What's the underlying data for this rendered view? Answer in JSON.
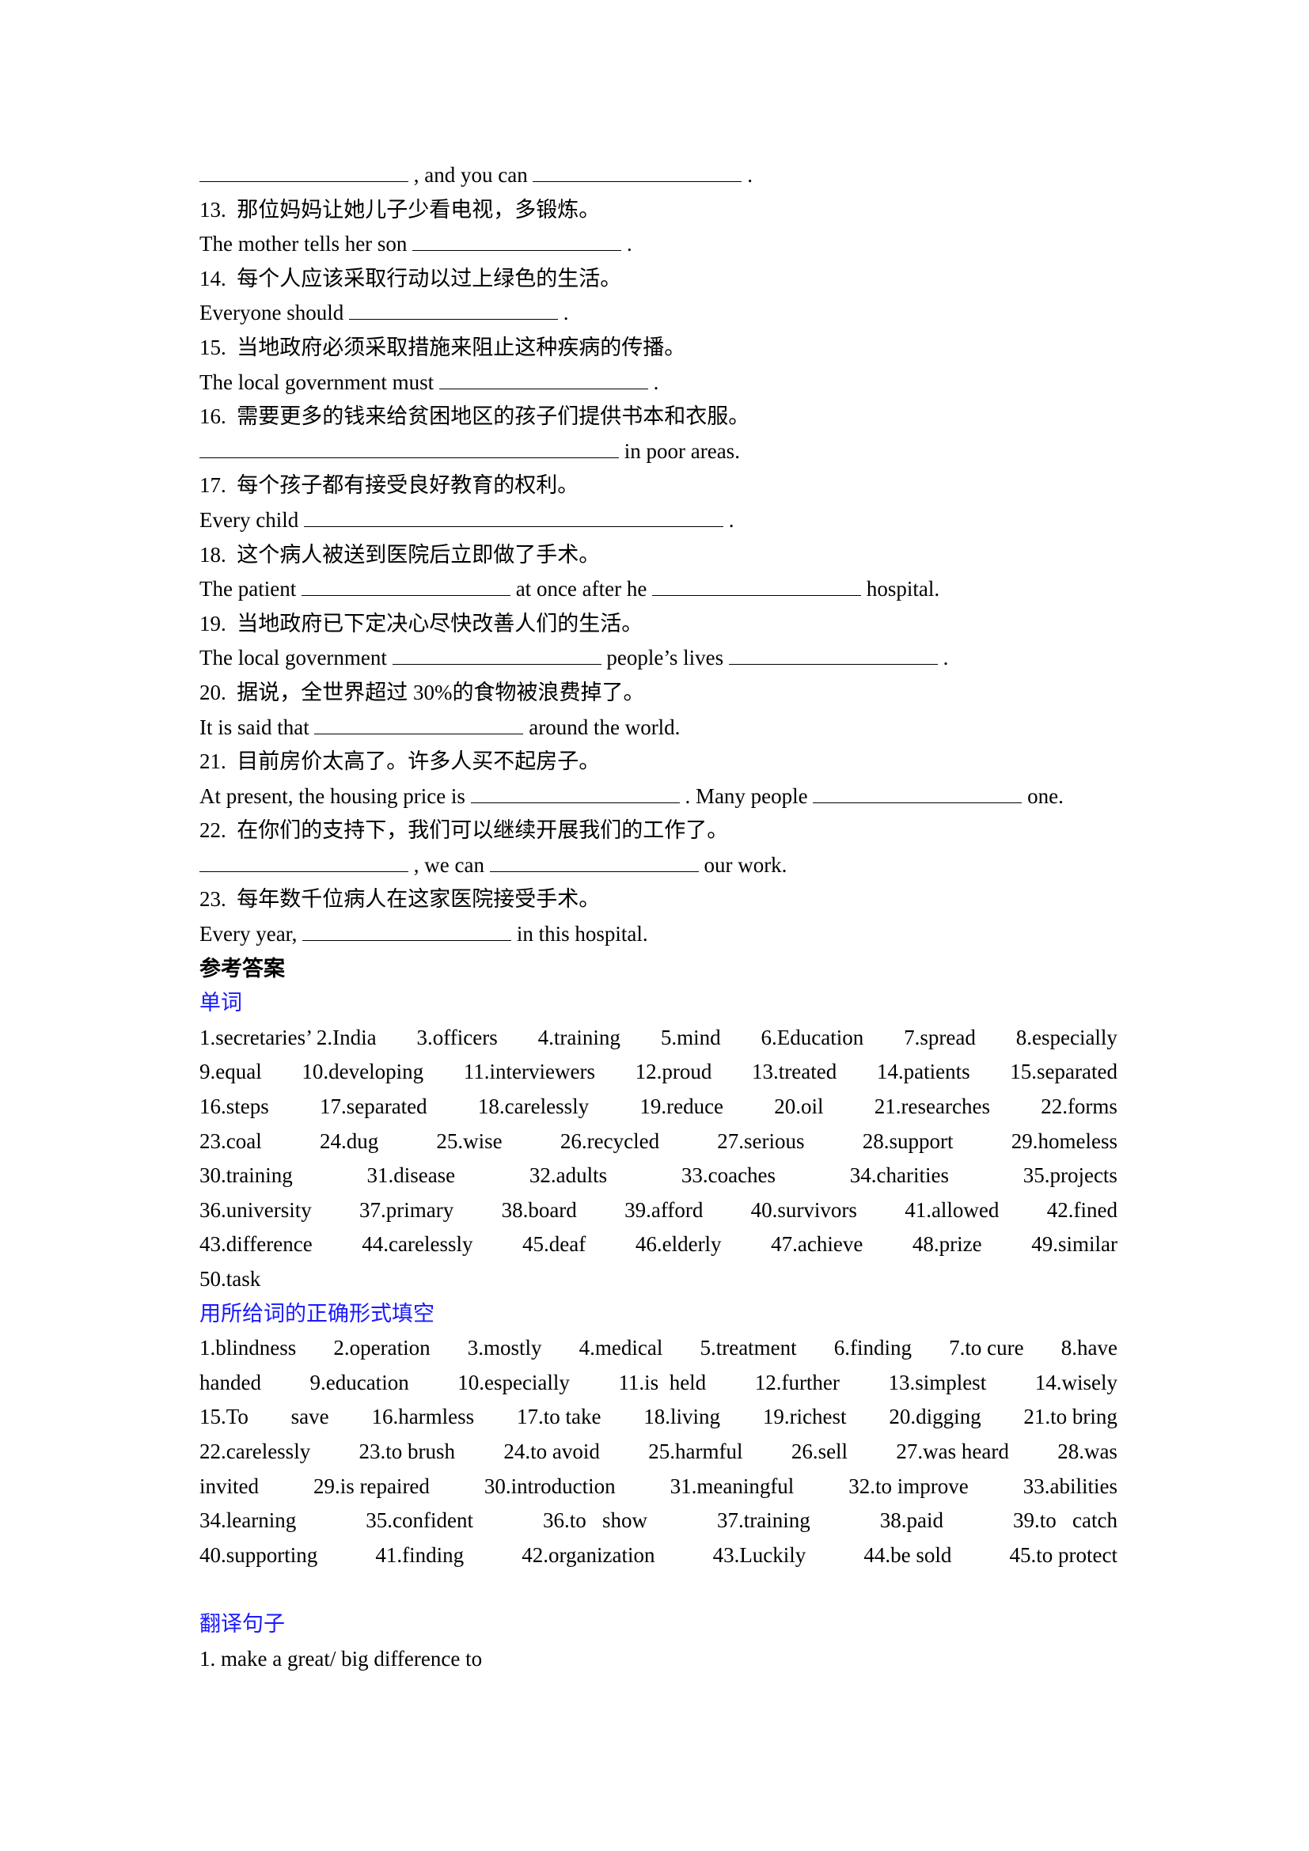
{
  "questions": {
    "q12_cont": {
      "mid": ", and you can",
      "end": "."
    },
    "q13": {
      "cn": "13.  那位妈妈让她儿子少看电视，多锻炼。",
      "en_start": "The mother tells her son",
      "end": "."
    },
    "q14": {
      "cn": "14.  每个人应该采取行动以过上绿色的生活。",
      "en_start": "Everyone should",
      "end": "."
    },
    "q15": {
      "cn": "15.  当地政府必须采取措施来阻止这种疾病的传播。",
      "en_start": "The local government must",
      "end": "."
    },
    "q16": {
      "cn": "16.  需要更多的钱来给贫困地区的孩子们提供书本和衣服。",
      "en_end": "in poor areas."
    },
    "q17": {
      "cn": "17.  每个孩子都有接受良好教育的权利。",
      "en_start": "Every child",
      "end": "."
    },
    "q18": {
      "cn": "18.  这个病人被送到医院后立即做了手术。",
      "en_start": "The patient",
      "mid": "at once after he",
      "end": "hospital."
    },
    "q19": {
      "cn": "19.  当地政府已下定决心尽快改善人们的生活。",
      "en_start": "The local government",
      "mid": "people’s lives",
      "end": "."
    },
    "q20": {
      "cn": "20.  据说，全世界超过 30%的食物被浪费掉了。",
      "en_start": "It is said that",
      "end": "around the world."
    },
    "q21": {
      "cn": "21.  目前房价太高了。许多人买不起房子。",
      "en_start": "At present, the housing price is",
      "mid": ". Many people",
      "end": "one."
    },
    "q22": {
      "cn": "22.  在你们的支持下，我们可以继续开展我们的工作了。",
      "mid": ", we can",
      "end": "our work."
    },
    "q23": {
      "cn": "23.  每年数千位病人在这家医院接受手术。",
      "en_start": "Every year,",
      "end": "in this hospital."
    }
  },
  "answers": {
    "heading": "参考答案",
    "vocab": {
      "title": "单词",
      "rows": [
        [
          "1.secretaries’ 2.India",
          "3.officers",
          "4.training",
          "5.mind",
          "6.Education",
          "7.spread",
          "8.especially"
        ],
        [
          "9.equal",
          "10.developing",
          "11.interviewers",
          "12.proud",
          "13.treated",
          "14.patients",
          "15.separated"
        ],
        [
          "16.steps",
          "17.separated",
          "18.carelessly",
          "19.reduce",
          "20.oil",
          "21.researches",
          "22.forms"
        ],
        [
          "23.coal",
          "24.dug",
          "25.wise",
          "26.recycled",
          "27.serious",
          "28.support",
          "29.homeless"
        ],
        [
          "30.training",
          "31.disease",
          "32.adults",
          "33.coaches",
          "34.charities",
          "35.projects"
        ],
        [
          "36.university",
          "37.primary",
          "38.board",
          "39.afford",
          "40.survivors",
          "41.allowed",
          "42.fined"
        ],
        [
          "43.difference",
          "44.carelessly",
          "45.deaf",
          "46.elderly",
          "47.achieve",
          "48.prize",
          "49.similar"
        ],
        [
          "50.task"
        ]
      ]
    },
    "fill": {
      "title": "用所给词的正确形式填空",
      "rows": [
        [
          "1.blindness",
          "2.operation",
          "3.mostly",
          "4.medical",
          "5.treatment",
          "6.finding",
          "7.to cure",
          "8.have"
        ],
        [
          "handed",
          "9.education",
          "10.especially",
          "11.is  held",
          "12.further",
          "13.simplest",
          "14.wisely"
        ],
        [
          "15.To",
          "save",
          "16.harmless",
          "17.to take",
          "18.living",
          "19.richest",
          "20.digging",
          "21.to bring"
        ],
        [
          "22.carelessly",
          "23.to brush",
          "24.to avoid",
          "25.harmful",
          "26.sell",
          "27.was heard",
          "28.was"
        ],
        [
          "invited",
          "29.is repaired",
          "30.introduction",
          "31.meaningful",
          "32.to improve",
          "33.abilities"
        ],
        [
          "34.learning",
          "35.confident",
          "36.to   show",
          "37.training",
          "38.paid",
          "39.to   catch"
        ],
        [
          "40.supporting",
          "41.finding",
          "42.organization",
          "43.Luckily",
          "44.be sold",
          "45.to protect"
        ]
      ]
    },
    "translate": {
      "title": "翻译句子",
      "items": [
        "1. make a great/ big difference to"
      ]
    }
  }
}
